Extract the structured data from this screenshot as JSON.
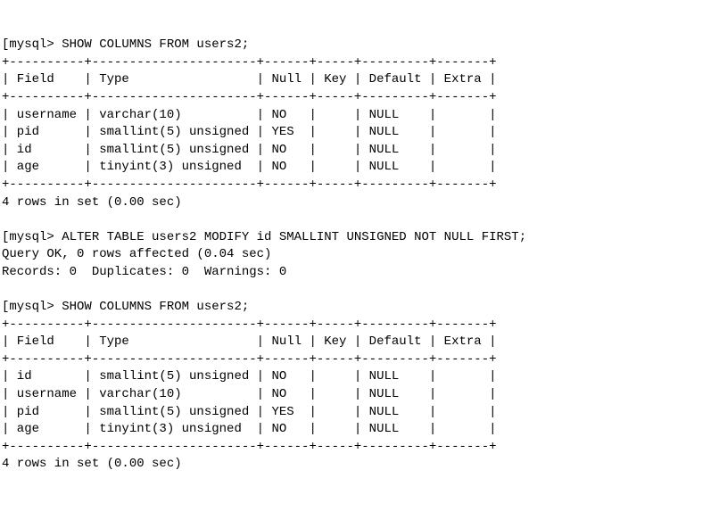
{
  "chart_data": [
    {
      "type": "table",
      "title": "SHOW COLUMNS FROM users2 (before)",
      "columns": [
        "Field",
        "Type",
        "Null",
        "Key",
        "Default",
        "Extra"
      ],
      "rows": [
        {
          "Field": "username",
          "Type": "varchar(10)",
          "Null": "NO",
          "Key": "",
          "Default": "NULL",
          "Extra": ""
        },
        {
          "Field": "pid",
          "Type": "smallint(5) unsigned",
          "Null": "YES",
          "Key": "",
          "Default": "NULL",
          "Extra": ""
        },
        {
          "Field": "id",
          "Type": "smallint(5) unsigned",
          "Null": "NO",
          "Key": "",
          "Default": "NULL",
          "Extra": ""
        },
        {
          "Field": "age",
          "Type": "tinyint(3) unsigned",
          "Null": "NO",
          "Key": "",
          "Default": "NULL",
          "Extra": ""
        }
      ]
    },
    {
      "type": "table",
      "title": "SHOW COLUMNS FROM users2 (after)",
      "columns": [
        "Field",
        "Type",
        "Null",
        "Key",
        "Default",
        "Extra"
      ],
      "rows": [
        {
          "Field": "id",
          "Type": "smallint(5) unsigned",
          "Null": "NO",
          "Key": "",
          "Default": "NULL",
          "Extra": ""
        },
        {
          "Field": "username",
          "Type": "varchar(10)",
          "Null": "NO",
          "Key": "",
          "Default": "NULL",
          "Extra": ""
        },
        {
          "Field": "pid",
          "Type": "smallint(5) unsigned",
          "Null": "YES",
          "Key": "",
          "Default": "NULL",
          "Extra": ""
        },
        {
          "Field": "age",
          "Type": "tinyint(3) unsigned",
          "Null": "NO",
          "Key": "",
          "Default": "NULL",
          "Extra": ""
        }
      ]
    }
  ],
  "prompt": "[mysql>",
  "cmd1": "SHOW COLUMNS FROM users2;",
  "border": "+----------+----------------------+------+-----+---------+-------+",
  "cols": {
    "field": "Field",
    "type": "Type",
    "null": "Null",
    "key": "Key",
    "default": "Default",
    "extra": "Extra"
  },
  "t1": {
    "r0": {
      "f": "username",
      "t": "varchar(10)",
      "n": "NO",
      "k": "",
      "d": "NULL",
      "e": ""
    },
    "r1": {
      "f": "pid",
      "t": "smallint(5) unsigned",
      "n": "YES",
      "k": "",
      "d": "NULL",
      "e": ""
    },
    "r2": {
      "f": "id",
      "t": "smallint(5) unsigned",
      "n": "NO",
      "k": "",
      "d": "NULL",
      "e": ""
    },
    "r3": {
      "f": "age",
      "t": "tinyint(3) unsigned",
      "n": "NO",
      "k": "",
      "d": "NULL",
      "e": ""
    }
  },
  "rows_in_set": "4 rows in set (0.00 sec)",
  "cmd2": "ALTER TABLE users2 MODIFY id SMALLINT UNSIGNED NOT NULL FIRST;",
  "query_ok": "Query OK, 0 rows affected (0.04 sec)",
  "records": "Records: 0  Duplicates: 0  Warnings: 0",
  "cmd3": "SHOW COLUMNS FROM users2;",
  "t2": {
    "r0": {
      "f": "id",
      "t": "smallint(5) unsigned",
      "n": "NO",
      "k": "",
      "d": "NULL",
      "e": ""
    },
    "r1": {
      "f": "username",
      "t": "varchar(10)",
      "n": "NO",
      "k": "",
      "d": "NULL",
      "e": ""
    },
    "r2": {
      "f": "pid",
      "t": "smallint(5) unsigned",
      "n": "YES",
      "k": "",
      "d": "NULL",
      "e": ""
    },
    "r3": {
      "f": "age",
      "t": "tinyint(3) unsigned",
      "n": "NO",
      "k": "",
      "d": "NULL",
      "e": ""
    }
  },
  "rows_in_set2": "4 rows in set (0.00 sec)",
  "widths": {
    "f": 8,
    "t": 20,
    "n": 4,
    "k": 3,
    "d": 7,
    "e": 5
  }
}
